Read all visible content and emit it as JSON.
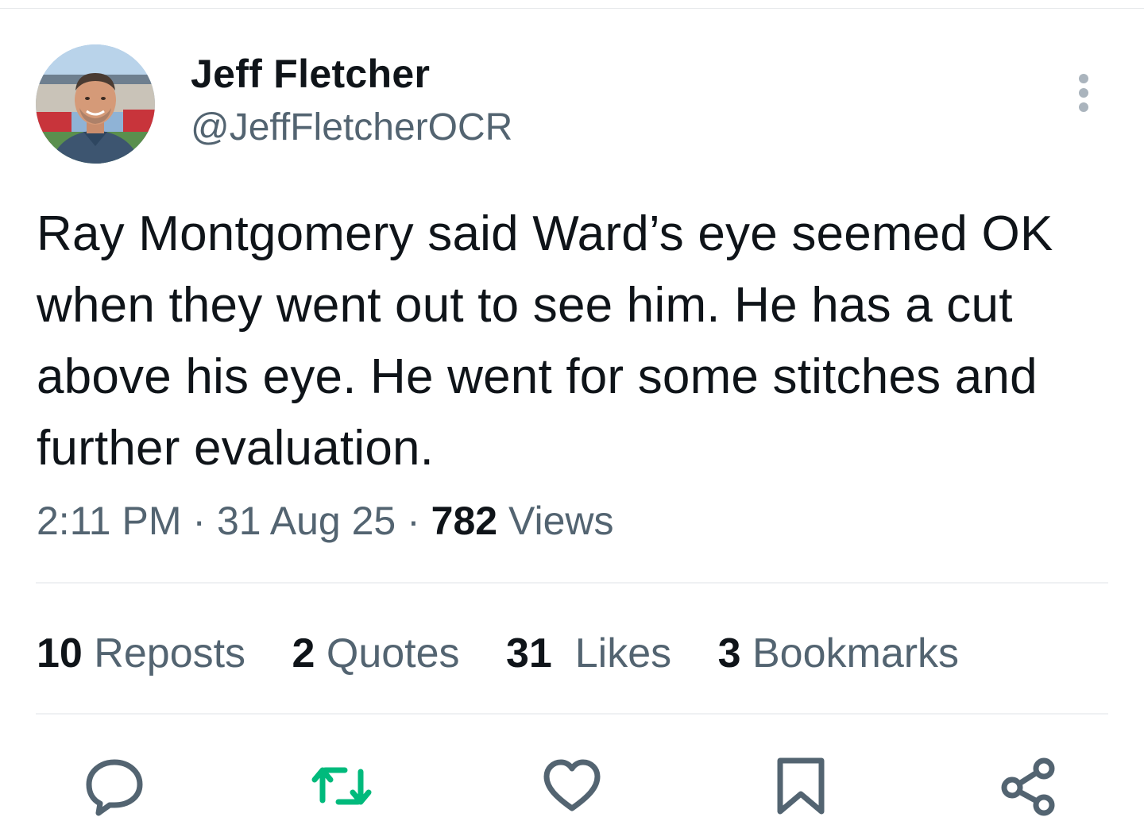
{
  "author": {
    "display_name": "Jeff Fletcher",
    "handle": "@JeffFletcherOCR"
  },
  "tweet": {
    "text": "Ray Montgomery said Ward’s eye seemed OK when they went out to see him. He has a cut above his eye. He went for some stitches and further evaluation.",
    "time": "2:11 PM",
    "date": "31 Aug 25",
    "separator": "·",
    "views_count": "782",
    "views_label": "Views"
  },
  "stats": [
    {
      "count": "10",
      "label": "Reposts"
    },
    {
      "count": "2",
      "label": "Quotes"
    },
    {
      "count": "31",
      "label": "Likes"
    },
    {
      "count": "3",
      "label": "Bookmarks"
    }
  ],
  "actions": [
    {
      "name": "reply",
      "icon": "reply-icon",
      "color": "#536471"
    },
    {
      "name": "repost",
      "icon": "repost-icon",
      "color": "#00ba7c"
    },
    {
      "name": "like",
      "icon": "heart-icon",
      "color": "#536471"
    },
    {
      "name": "bookmark",
      "icon": "bookmark-icon",
      "color": "#536471"
    },
    {
      "name": "share",
      "icon": "share-icon",
      "color": "#536471"
    }
  ],
  "colors": {
    "text_primary": "#0f1419",
    "text_secondary": "#536471",
    "divider": "#eff1f3",
    "repost_active": "#00ba7c"
  }
}
